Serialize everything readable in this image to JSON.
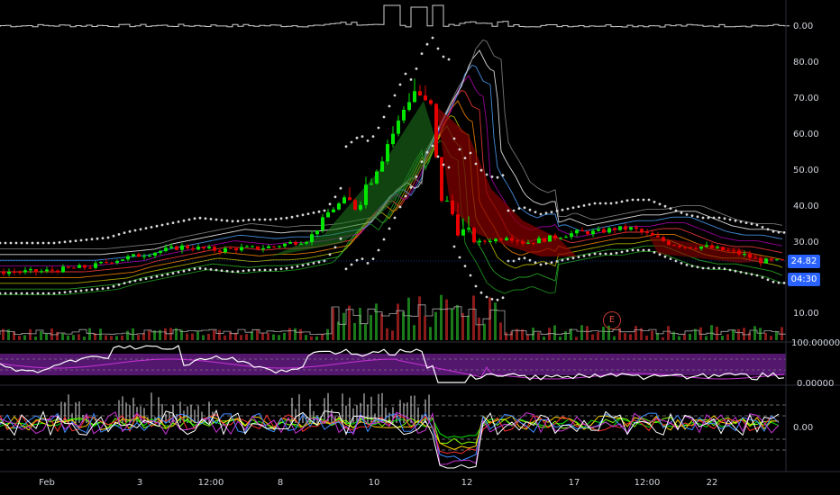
{
  "chart_data": {
    "type": "candlestick",
    "x_labels": [
      "Feb",
      "3",
      "12:00",
      "8",
      "10",
      "12",
      "17",
      "12:00",
      "22"
    ],
    "price_axis": {
      "ticks": [
        "80.00",
        "70.00",
        "60.00",
        "50.00",
        "40.00",
        "30.00",
        "10.00"
      ],
      "range": [
        5,
        85
      ]
    },
    "top_indicator_axis": {
      "tick": "0.00"
    },
    "rsi_panel_axis": {
      "ticks": [
        "100.00000",
        "0.00000"
      ]
    },
    "bottom_panel_axis": {
      "tick": "0.00"
    },
    "last_price": "24.82",
    "countdown": "04:30",
    "earnings_marker": "E",
    "price_path": [
      [
        0,
        22
      ],
      [
        20,
        22
      ],
      [
        40,
        22
      ],
      [
        60,
        22.5
      ],
      [
        80,
        23
      ],
      [
        100,
        23.5
      ],
      [
        120,
        25
      ],
      [
        140,
        26
      ],
      [
        160,
        27
      ],
      [
        180,
        28
      ],
      [
        200,
        29
      ],
      [
        220,
        28.5
      ],
      [
        240,
        28
      ],
      [
        260,
        28.5
      ],
      [
        280,
        28.5
      ],
      [
        300,
        29
      ],
      [
        320,
        30
      ],
      [
        340,
        31
      ],
      [
        350,
        34
      ],
      [
        360,
        38
      ],
      [
        370,
        40
      ],
      [
        380,
        42
      ],
      [
        390,
        40
      ],
      [
        400,
        44
      ],
      [
        410,
        49
      ],
      [
        420,
        54
      ],
      [
        430,
        59
      ],
      [
        440,
        63
      ],
      [
        450,
        70
      ],
      [
        460,
        73
      ],
      [
        470,
        68
      ],
      [
        478,
        67
      ],
      [
        484,
        45
      ],
      [
        490,
        42
      ],
      [
        500,
        38
      ],
      [
        510,
        33
      ],
      [
        520,
        31
      ],
      [
        530,
        30
      ],
      [
        540,
        31
      ],
      [
        550,
        31
      ],
      [
        560,
        32
      ],
      [
        580,
        30
      ],
      [
        600,
        31
      ],
      [
        620,
        32
      ],
      [
        640,
        33
      ],
      [
        660,
        33
      ],
      [
        680,
        34
      ],
      [
        700,
        34
      ],
      [
        720,
        32
      ],
      [
        740,
        30
      ],
      [
        760,
        29
      ],
      [
        780,
        29
      ],
      [
        800,
        28
      ],
      [
        820,
        27
      ],
      [
        840,
        25
      ],
      [
        860,
        24.82
      ],
      [
        870,
        24.8
      ]
    ],
    "colors": {
      "up": "#00e600",
      "down": "#e60000",
      "bull_ribbon": "#1f7a1f",
      "bear_ribbon": "#8a0000",
      "dots": "#d9d9d9",
      "rsi_band": "#5c1b7a",
      "rsi_line": "#ffffff",
      "rsi_signal": "#c833d6",
      "price_tag": "#2962ff"
    }
  }
}
